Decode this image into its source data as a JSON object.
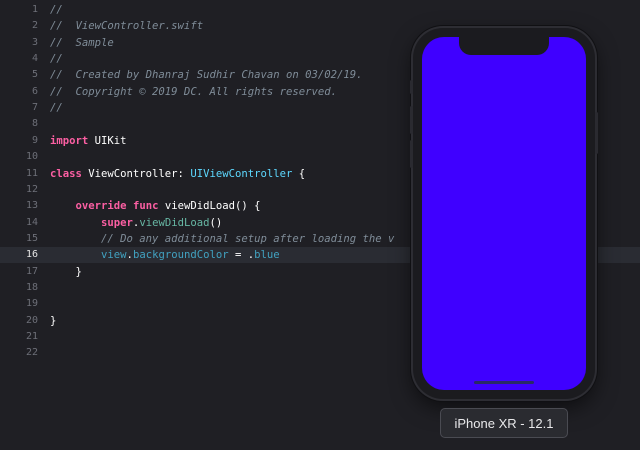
{
  "editor": {
    "current_line": 16,
    "lines": [
      {
        "n": "1",
        "tokens": [
          {
            "t": "//",
            "c": "comment"
          }
        ]
      },
      {
        "n": "2",
        "tokens": [
          {
            "t": "//  ViewController.swift",
            "c": "comment"
          }
        ]
      },
      {
        "n": "3",
        "tokens": [
          {
            "t": "//  Sample",
            "c": "comment"
          }
        ]
      },
      {
        "n": "4",
        "tokens": [
          {
            "t": "//",
            "c": "comment"
          }
        ]
      },
      {
        "n": "5",
        "tokens": [
          {
            "t": "//  Created by Dhanraj Sudhir Chavan on 03/02/19.",
            "c": "comment"
          }
        ]
      },
      {
        "n": "6",
        "tokens": [
          {
            "t": "//  Copyright © 2019 DC. All rights reserved.",
            "c": "comment"
          }
        ]
      },
      {
        "n": "7",
        "tokens": [
          {
            "t": "//",
            "c": "comment"
          }
        ]
      },
      {
        "n": "8",
        "tokens": []
      },
      {
        "n": "9",
        "tokens": [
          {
            "t": "import",
            "c": "keyword"
          },
          {
            "t": " UIKit",
            "c": "plain"
          }
        ]
      },
      {
        "n": "10",
        "tokens": []
      },
      {
        "n": "11",
        "tokens": [
          {
            "t": "class",
            "c": "keyword"
          },
          {
            "t": " ViewController: ",
            "c": "plain"
          },
          {
            "t": "UIViewController",
            "c": "type"
          },
          {
            "t": " {",
            "c": "plain"
          }
        ]
      },
      {
        "n": "12",
        "tokens": []
      },
      {
        "n": "13",
        "tokens": [
          {
            "t": "    override",
            "c": "keyword"
          },
          {
            "t": " ",
            "c": "plain"
          },
          {
            "t": "func",
            "c": "keyword"
          },
          {
            "t": " viewDidLoad() {",
            "c": "plain"
          }
        ]
      },
      {
        "n": "14",
        "tokens": [
          {
            "t": "        super",
            "c": "keyword"
          },
          {
            "t": ".",
            "c": "plain"
          },
          {
            "t": "viewDidLoad",
            "c": "method"
          },
          {
            "t": "()",
            "c": "plain"
          }
        ]
      },
      {
        "n": "15",
        "tokens": [
          {
            "t": "        // Do any additional setup after loading the v",
            "c": "comment"
          }
        ]
      },
      {
        "n": "16",
        "tokens": [
          {
            "t": "        ",
            "c": "plain"
          },
          {
            "t": "view",
            "c": "prop"
          },
          {
            "t": ".",
            "c": "plain"
          },
          {
            "t": "backgroundColor",
            "c": "prop"
          },
          {
            "t": " = .",
            "c": "plain"
          },
          {
            "t": "blue",
            "c": "enum"
          }
        ]
      },
      {
        "n": "17",
        "tokens": [
          {
            "t": "    }",
            "c": "plain"
          }
        ]
      },
      {
        "n": "18",
        "tokens": []
      },
      {
        "n": "19",
        "tokens": []
      },
      {
        "n": "20",
        "tokens": [
          {
            "t": "}",
            "c": "plain"
          }
        ]
      },
      {
        "n": "21",
        "tokens": []
      },
      {
        "n": "22",
        "tokens": []
      }
    ]
  },
  "simulator": {
    "device_label": "iPhone XR - 12.1",
    "screen_color": "#3f00ff"
  },
  "colors": {
    "background": "#1f1f24",
    "current_line_highlight": "#2a2c33",
    "comment": "#7f8c98",
    "keyword": "#fc5fa3",
    "type": "#5dd8ff"
  }
}
